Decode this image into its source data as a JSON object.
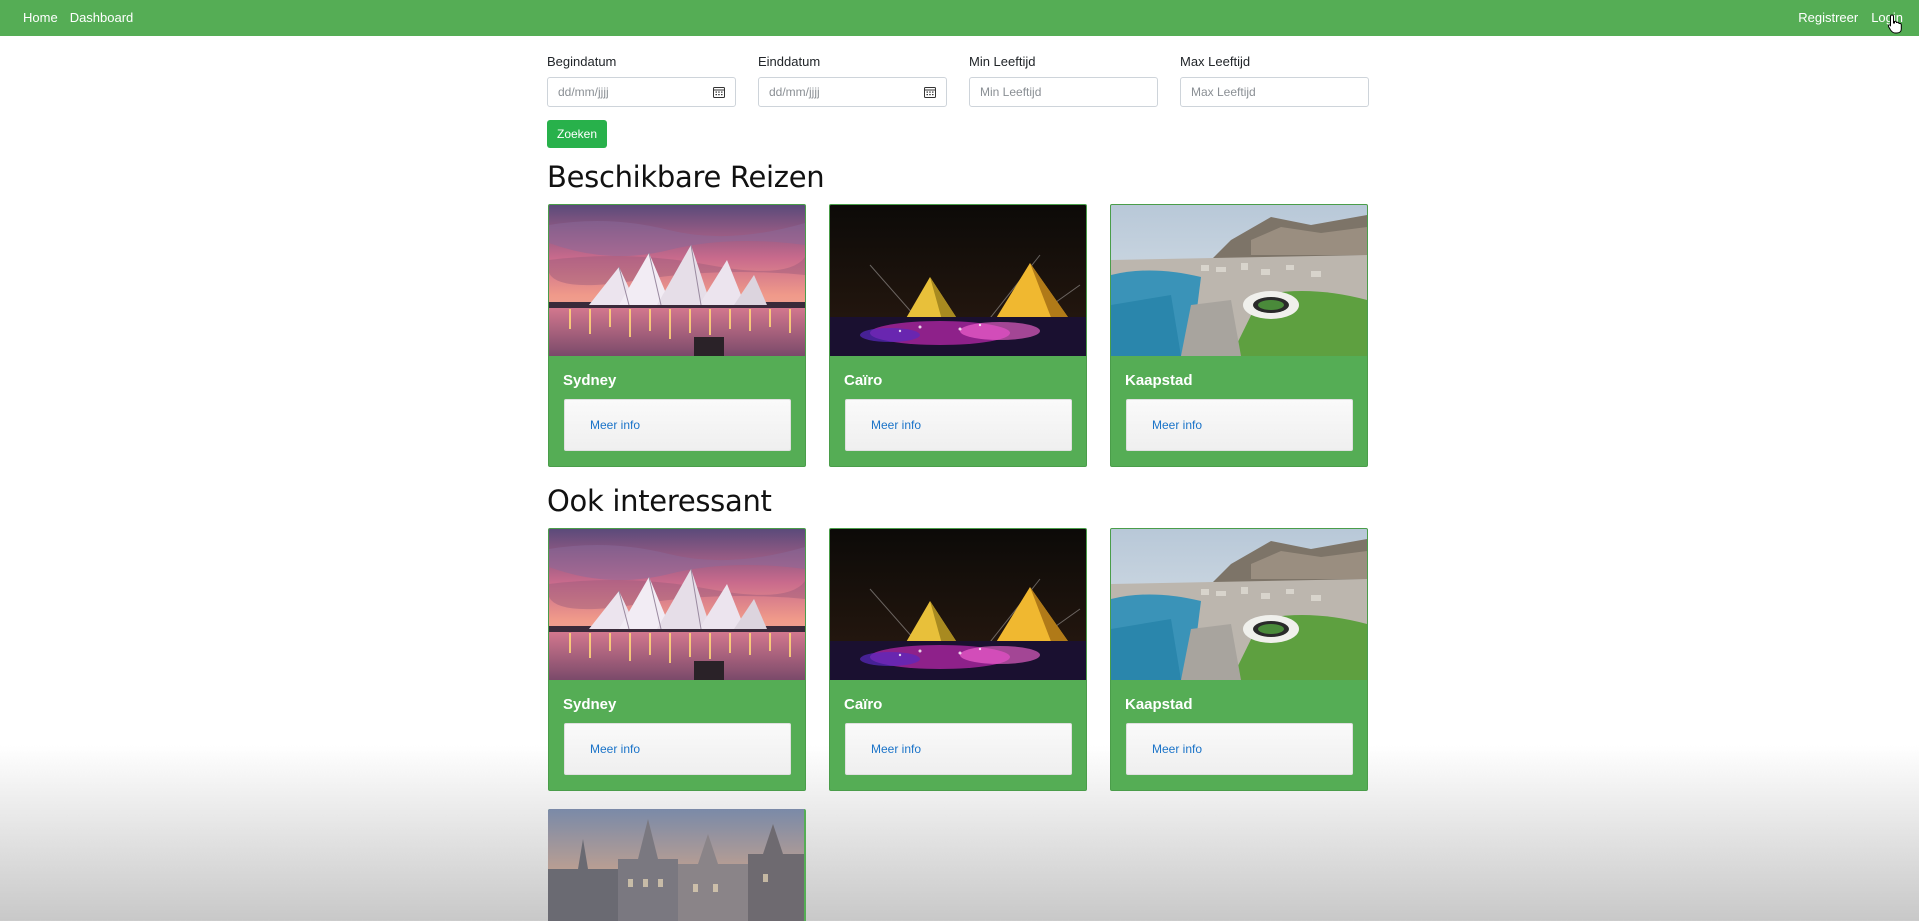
{
  "nav": {
    "left": [
      "Home",
      "Dashboard"
    ],
    "right": [
      "Registreer",
      "Login"
    ]
  },
  "filters": {
    "begin": {
      "label": "Begindatum",
      "placeholder": "dd/mm/jjjj"
    },
    "end": {
      "label": "Einddatum",
      "placeholder": "dd/mm/jjjj"
    },
    "min_age": {
      "label": "Min Leeftijd",
      "placeholder": "Min Leeftijd"
    },
    "max_age": {
      "label": "Max Leeftijd",
      "placeholder": "Max Leeftijd"
    },
    "search_label": "Zoeken"
  },
  "sections": {
    "available": {
      "title": "Beschikbare Reizen",
      "cards": [
        {
          "title": "Sydney",
          "button": "Meer info",
          "image": "sydney-opera-house"
        },
        {
          "title": "Caïro",
          "button": "Meer info",
          "image": "pyramids-night"
        },
        {
          "title": "Kaapstad",
          "button": "Meer info",
          "image": "cape-town-aerial"
        }
      ]
    },
    "interesting": {
      "title": "Ook interessant",
      "cards": [
        {
          "title": "Sydney",
          "button": "Meer info",
          "image": "sydney-opera-house"
        },
        {
          "title": "Caïro",
          "button": "Meer info",
          "image": "pyramids-night"
        },
        {
          "title": "Kaapstad",
          "button": "Meer info",
          "image": "cape-town-aerial"
        },
        {
          "image": "ghent-old-town"
        }
      ]
    }
  },
  "colors": {
    "navbar": "#55ad55",
    "card": "#55ad55",
    "search_button": "#28b14b",
    "link": "#1a73c8"
  }
}
